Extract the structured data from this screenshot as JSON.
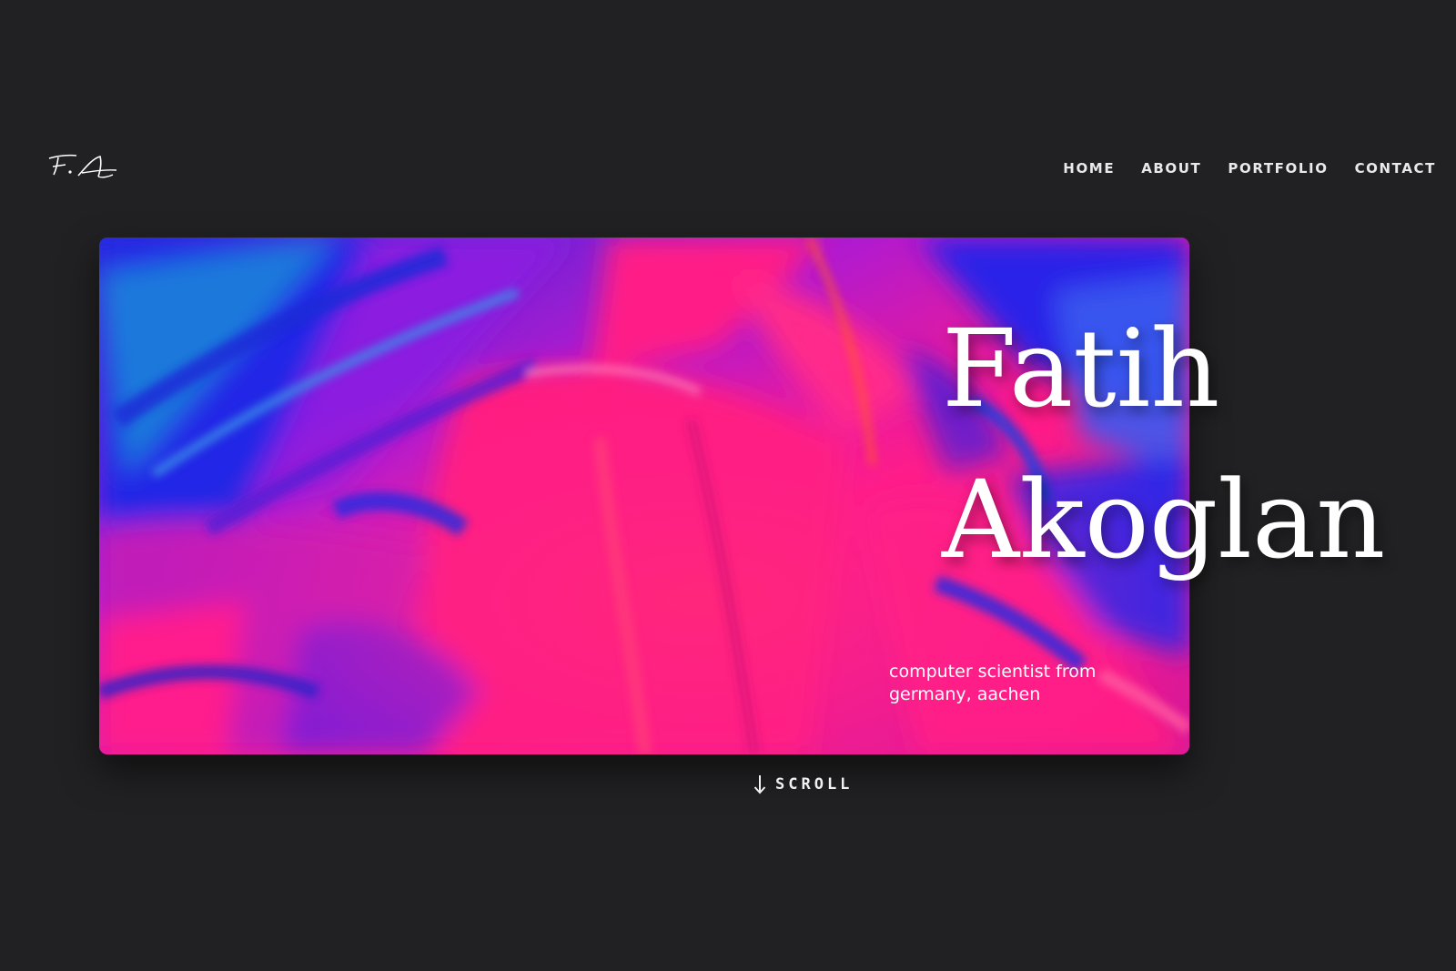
{
  "logo": {
    "icon": "signature-logo"
  },
  "nav": {
    "items": [
      {
        "label": "HOME"
      },
      {
        "label": "ABOUT"
      },
      {
        "label": "PORTFOLIO"
      },
      {
        "label": "CONTACT"
      }
    ]
  },
  "hero": {
    "first_name": "Fatih",
    "last_name": "Akoglan",
    "subtitle_line1": "computer scientist from",
    "subtitle_line2": "germany, aachen",
    "image": "abstract-paint-artwork"
  },
  "scroll": {
    "label": "SCROLL",
    "icon": "arrow-down-icon"
  },
  "colors": {
    "background": "#212123",
    "text": "#ffffff",
    "paint_pink": "#ff1f8e",
    "paint_blue": "#1e22e0",
    "paint_purple": "#8a1fd6"
  }
}
